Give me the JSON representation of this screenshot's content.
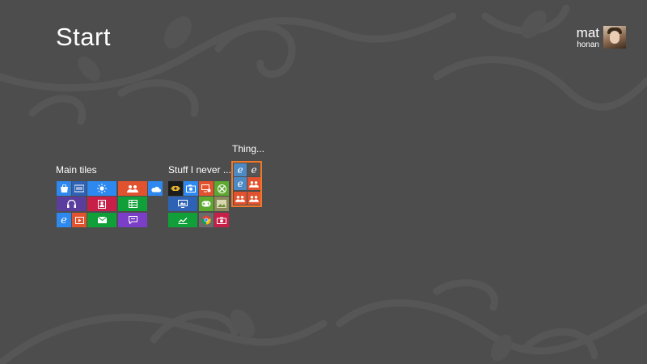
{
  "screen": {
    "title": "Start",
    "background_color": "#4d4d4d",
    "accent_color": "#f07828"
  },
  "user": {
    "first_name": "mat",
    "last_name": "honan"
  },
  "groups": [
    {
      "title": "Main tiles",
      "tiles": [
        {
          "icon": "store-icon",
          "color": "#2d89ef"
        },
        {
          "icon": "news-icon",
          "color": "#2e62b5"
        },
        {
          "icon": "weather-icon",
          "color": "#2d89ef"
        },
        {
          "icon": "people-icon",
          "color": "#e1532e"
        },
        {
          "icon": "skydrive-icon",
          "color": "#2d89ef"
        },
        {
          "icon": "music-icon",
          "color": "#5b3d9e"
        },
        {
          "icon": "contact-card-icon",
          "color": "#c81f48"
        },
        {
          "icon": "finance-grid-icon",
          "color": "#109f38"
        },
        {
          "icon": "internet-explorer-icon",
          "color": "#2d89ef"
        },
        {
          "icon": "video-icon",
          "color": "#e1532e"
        },
        {
          "icon": "mail-icon",
          "color": "#109f38"
        },
        {
          "icon": "messaging-icon",
          "color": "#7a3ec7"
        }
      ]
    },
    {
      "title": "Stuff I never ...",
      "tiles": [
        {
          "icon": "app-thumbnail-icon",
          "color": "#1c1c1c"
        },
        {
          "icon": "camera-roll-icon",
          "color": "#2d89ef"
        },
        {
          "icon": "remote-desktop-icon",
          "color": "#e1532e"
        },
        {
          "icon": "xbox-icon",
          "color": "#5da82e"
        },
        {
          "icon": "desktop-icon",
          "color": "#2e62b5"
        },
        {
          "icon": "games-icon",
          "color": "#5da82e"
        },
        {
          "icon": "photos-icon",
          "color": "#8a8a5a"
        },
        {
          "icon": "finance-chart-icon",
          "color": "#109f38"
        },
        {
          "icon": "chrome-icon",
          "color": "#6a6a6a"
        },
        {
          "icon": "camera-icon",
          "color": "#c81f48"
        }
      ]
    },
    {
      "title": "Thing...",
      "tiles": [
        {
          "icon": "internet-explorer-icon",
          "color": "#4d8ac4"
        },
        {
          "icon": "internet-explorer-icon",
          "color": "#555555"
        },
        {
          "icon": "internet-explorer-icon",
          "color": "#4d8ac4"
        },
        {
          "icon": "people-icon",
          "color": "#e1532e"
        },
        {
          "icon": "people-icon",
          "color": "#e1532e"
        },
        {
          "icon": "people-icon",
          "color": "#e1532e"
        }
      ]
    }
  ]
}
